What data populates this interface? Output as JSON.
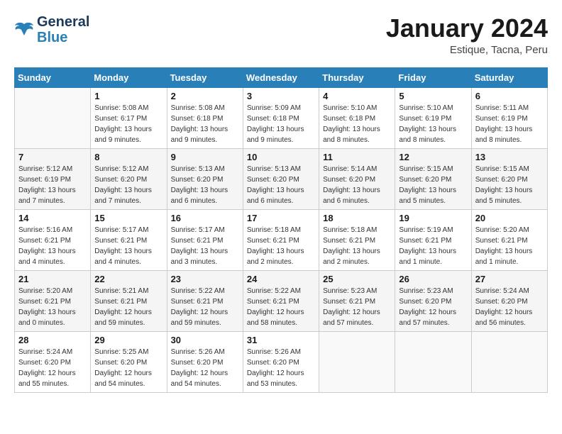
{
  "header": {
    "logo_line1": "General",
    "logo_line2": "Blue",
    "month_title": "January 2024",
    "location": "Estique, Tacna, Peru"
  },
  "days_of_week": [
    "Sunday",
    "Monday",
    "Tuesday",
    "Wednesday",
    "Thursday",
    "Friday",
    "Saturday"
  ],
  "weeks": [
    [
      {
        "day": "",
        "info": ""
      },
      {
        "day": "1",
        "info": "Sunrise: 5:08 AM\nSunset: 6:17 PM\nDaylight: 13 hours\nand 9 minutes."
      },
      {
        "day": "2",
        "info": "Sunrise: 5:08 AM\nSunset: 6:18 PM\nDaylight: 13 hours\nand 9 minutes."
      },
      {
        "day": "3",
        "info": "Sunrise: 5:09 AM\nSunset: 6:18 PM\nDaylight: 13 hours\nand 9 minutes."
      },
      {
        "day": "4",
        "info": "Sunrise: 5:10 AM\nSunset: 6:18 PM\nDaylight: 13 hours\nand 8 minutes."
      },
      {
        "day": "5",
        "info": "Sunrise: 5:10 AM\nSunset: 6:19 PM\nDaylight: 13 hours\nand 8 minutes."
      },
      {
        "day": "6",
        "info": "Sunrise: 5:11 AM\nSunset: 6:19 PM\nDaylight: 13 hours\nand 8 minutes."
      }
    ],
    [
      {
        "day": "7",
        "info": "Sunrise: 5:12 AM\nSunset: 6:19 PM\nDaylight: 13 hours\nand 7 minutes."
      },
      {
        "day": "8",
        "info": "Sunrise: 5:12 AM\nSunset: 6:20 PM\nDaylight: 13 hours\nand 7 minutes."
      },
      {
        "day": "9",
        "info": "Sunrise: 5:13 AM\nSunset: 6:20 PM\nDaylight: 13 hours\nand 6 minutes."
      },
      {
        "day": "10",
        "info": "Sunrise: 5:13 AM\nSunset: 6:20 PM\nDaylight: 13 hours\nand 6 minutes."
      },
      {
        "day": "11",
        "info": "Sunrise: 5:14 AM\nSunset: 6:20 PM\nDaylight: 13 hours\nand 6 minutes."
      },
      {
        "day": "12",
        "info": "Sunrise: 5:15 AM\nSunset: 6:20 PM\nDaylight: 13 hours\nand 5 minutes."
      },
      {
        "day": "13",
        "info": "Sunrise: 5:15 AM\nSunset: 6:20 PM\nDaylight: 13 hours\nand 5 minutes."
      }
    ],
    [
      {
        "day": "14",
        "info": "Sunrise: 5:16 AM\nSunset: 6:21 PM\nDaylight: 13 hours\nand 4 minutes."
      },
      {
        "day": "15",
        "info": "Sunrise: 5:17 AM\nSunset: 6:21 PM\nDaylight: 13 hours\nand 4 minutes."
      },
      {
        "day": "16",
        "info": "Sunrise: 5:17 AM\nSunset: 6:21 PM\nDaylight: 13 hours\nand 3 minutes."
      },
      {
        "day": "17",
        "info": "Sunrise: 5:18 AM\nSunset: 6:21 PM\nDaylight: 13 hours\nand 2 minutes."
      },
      {
        "day": "18",
        "info": "Sunrise: 5:18 AM\nSunset: 6:21 PM\nDaylight: 13 hours\nand 2 minutes."
      },
      {
        "day": "19",
        "info": "Sunrise: 5:19 AM\nSunset: 6:21 PM\nDaylight: 13 hours\nand 1 minute."
      },
      {
        "day": "20",
        "info": "Sunrise: 5:20 AM\nSunset: 6:21 PM\nDaylight: 13 hours\nand 1 minute."
      }
    ],
    [
      {
        "day": "21",
        "info": "Sunrise: 5:20 AM\nSunset: 6:21 PM\nDaylight: 13 hours\nand 0 minutes."
      },
      {
        "day": "22",
        "info": "Sunrise: 5:21 AM\nSunset: 6:21 PM\nDaylight: 12 hours\nand 59 minutes."
      },
      {
        "day": "23",
        "info": "Sunrise: 5:22 AM\nSunset: 6:21 PM\nDaylight: 12 hours\nand 59 minutes."
      },
      {
        "day": "24",
        "info": "Sunrise: 5:22 AM\nSunset: 6:21 PM\nDaylight: 12 hours\nand 58 minutes."
      },
      {
        "day": "25",
        "info": "Sunrise: 5:23 AM\nSunset: 6:21 PM\nDaylight: 12 hours\nand 57 minutes."
      },
      {
        "day": "26",
        "info": "Sunrise: 5:23 AM\nSunset: 6:20 PM\nDaylight: 12 hours\nand 57 minutes."
      },
      {
        "day": "27",
        "info": "Sunrise: 5:24 AM\nSunset: 6:20 PM\nDaylight: 12 hours\nand 56 minutes."
      }
    ],
    [
      {
        "day": "28",
        "info": "Sunrise: 5:24 AM\nSunset: 6:20 PM\nDaylight: 12 hours\nand 55 minutes."
      },
      {
        "day": "29",
        "info": "Sunrise: 5:25 AM\nSunset: 6:20 PM\nDaylight: 12 hours\nand 54 minutes."
      },
      {
        "day": "30",
        "info": "Sunrise: 5:26 AM\nSunset: 6:20 PM\nDaylight: 12 hours\nand 54 minutes."
      },
      {
        "day": "31",
        "info": "Sunrise: 5:26 AM\nSunset: 6:20 PM\nDaylight: 12 hours\nand 53 minutes."
      },
      {
        "day": "",
        "info": ""
      },
      {
        "day": "",
        "info": ""
      },
      {
        "day": "",
        "info": ""
      }
    ]
  ]
}
